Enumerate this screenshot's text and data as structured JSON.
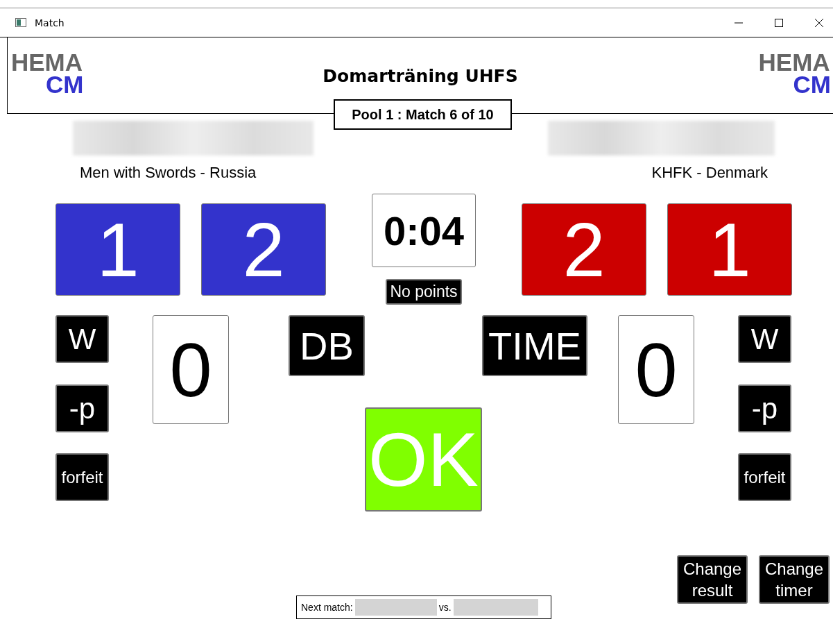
{
  "window": {
    "title": "Match"
  },
  "header": {
    "logos": [
      {
        "top": "HEMA",
        "bottom": "CM"
      },
      {
        "top": "HEMA",
        "bottom": "CM"
      }
    ],
    "title": "Domarträning UHFS",
    "match_info": "Pool 1 : Match 6 of 10"
  },
  "fighters": [
    {
      "club": "Men with Swords - Russia",
      "color": "#3333cc",
      "scores": [
        "1",
        "2"
      ],
      "penalty": "0",
      "buttons": [
        "W",
        "-p",
        "forfeit"
      ]
    },
    {
      "club": "KHFK - Denmark",
      "color": "#cc0000",
      "scores": [
        "2",
        "1"
      ],
      "penalty": "0",
      "buttons": [
        "W",
        "-p",
        "forfeit"
      ]
    }
  ],
  "timer": {
    "time": "0:04",
    "status": "No points"
  },
  "actions": [
    "DB",
    "TIME"
  ],
  "ok": {
    "label": "OK",
    "color": "#80ff00"
  },
  "corner_buttons": [
    "Change result",
    "Change timer"
  ],
  "next_match": {
    "label": "Next match:",
    "vs": "vs."
  }
}
